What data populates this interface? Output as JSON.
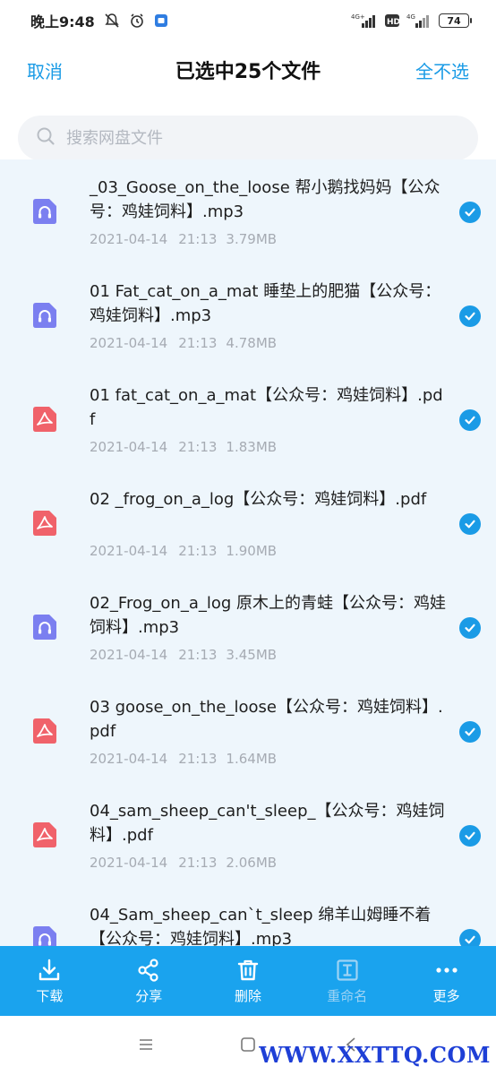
{
  "status_bar": {
    "time": "晚上9:48",
    "network_1": "4G+",
    "network_2": "4G",
    "hd_label": "HD",
    "battery": "74"
  },
  "header": {
    "cancel_label": "取消",
    "title": "已选中25个文件",
    "deselect_all_label": "全不选"
  },
  "search": {
    "placeholder": "搜索网盘文件"
  },
  "files": [
    {
      "name": "_03_Goose_on_the_loose 帮小鹅找妈妈【公众号：鸡娃饲料】.mp3",
      "date": "2021-04-14",
      "time": "21:13",
      "size": "3.79MB",
      "type": "audio",
      "selected": true
    },
    {
      "name": "01 Fat_cat_on_a_mat 睡垫上的肥猫【公众号：鸡娃饲料】.mp3",
      "date": "2021-04-14",
      "time": "21:13",
      "size": "4.78MB",
      "type": "audio",
      "selected": true
    },
    {
      "name": "01 fat_cat_on_a_mat【公众号：鸡娃饲料】.pdf",
      "date": "2021-04-14",
      "time": "21:13",
      "size": "1.83MB",
      "type": "pdf",
      "selected": true
    },
    {
      "name": "02 _frog_on_a_log【公众号：鸡娃饲料】.pdf",
      "date": "2021-04-14",
      "time": "21:13",
      "size": "1.90MB",
      "type": "pdf",
      "selected": true
    },
    {
      "name": "02_Frog_on_a_log 原木上的青蛙【公众号：鸡娃饲料】.mp3",
      "date": "2021-04-14",
      "time": "21:13",
      "size": "3.45MB",
      "type": "audio",
      "selected": true
    },
    {
      "name": "03 goose_on_the_loose【公众号：鸡娃饲料】.pdf",
      "date": "2021-04-14",
      "time": "21:13",
      "size": "1.64MB",
      "type": "pdf",
      "selected": true
    },
    {
      "name": "04_sam_sheep_can't_sleep_【公众号：鸡娃饲料】.pdf",
      "date": "2021-04-14",
      "time": "21:13",
      "size": "2.06MB",
      "type": "pdf",
      "selected": true
    },
    {
      "name": "04_Sam_sheep_can`t_sleep  绵羊山姆睡不着【公众号：鸡娃饲料】.mp3",
      "date": "",
      "time": "",
      "size": "",
      "type": "audio",
      "selected": true
    }
  ],
  "actions": [
    {
      "label": "下载",
      "icon": "download-icon",
      "enabled": true
    },
    {
      "label": "分享",
      "icon": "share-icon",
      "enabled": true
    },
    {
      "label": "删除",
      "icon": "trash-icon",
      "enabled": true
    },
    {
      "label": "重命名",
      "icon": "rename-icon",
      "enabled": false
    },
    {
      "label": "更多",
      "icon": "more-icon",
      "enabled": true
    }
  ],
  "watermark": "WWW.XXTTQ.COM",
  "colors": {
    "accent": "#1a9be6",
    "action_bar": "#1aa3ee",
    "list_background": "#eef6fc",
    "audio_icon": "#7b7ff0",
    "pdf_icon": "#f0626a"
  }
}
